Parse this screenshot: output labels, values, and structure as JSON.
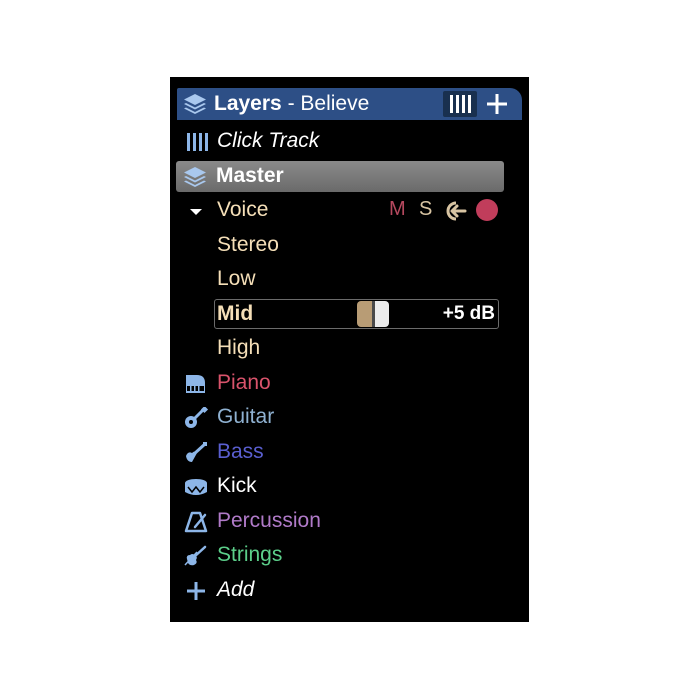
{
  "header": {
    "title": "Layers",
    "subtitle": "- Believe",
    "icon": "layers-icon"
  },
  "rows": {
    "click_track": {
      "label": "Click Track",
      "icon": "click-track-icon",
      "color": "#ffffff"
    },
    "master": {
      "label": "Master",
      "icon": "layers-icon",
      "color": "#ffffff"
    },
    "voice": {
      "label": "Voice",
      "icon": "chevron-down-icon",
      "color": "#f5dfb8",
      "mute": "M",
      "solo": "S",
      "input_icon": "input-arrow-icon",
      "record_color": "#c13d5b"
    },
    "stereo": {
      "label": "Stereo"
    },
    "low": {
      "label": "Low"
    },
    "mid": {
      "label": "Mid",
      "gain": "+5 dB"
    },
    "high": {
      "label": "High"
    },
    "piano": {
      "label": "Piano",
      "icon": "piano-icon",
      "color": "#d9536b"
    },
    "guitar": {
      "label": "Guitar",
      "icon": "guitar-icon",
      "color": "#8fb1d1"
    },
    "bass": {
      "label": "Bass",
      "icon": "bass-icon",
      "color": "#5a5fd0"
    },
    "kick": {
      "label": "Kick",
      "icon": "drum-icon",
      "color": "#ffffff"
    },
    "percussion": {
      "label": "Percussion",
      "icon": "metronome-icon",
      "color": "#b07ac8"
    },
    "strings": {
      "label": "Strings",
      "icon": "violin-icon",
      "color": "#5ccf8a"
    },
    "add": {
      "label": "Add",
      "icon": "plus-icon",
      "color": "#ffffff"
    }
  }
}
